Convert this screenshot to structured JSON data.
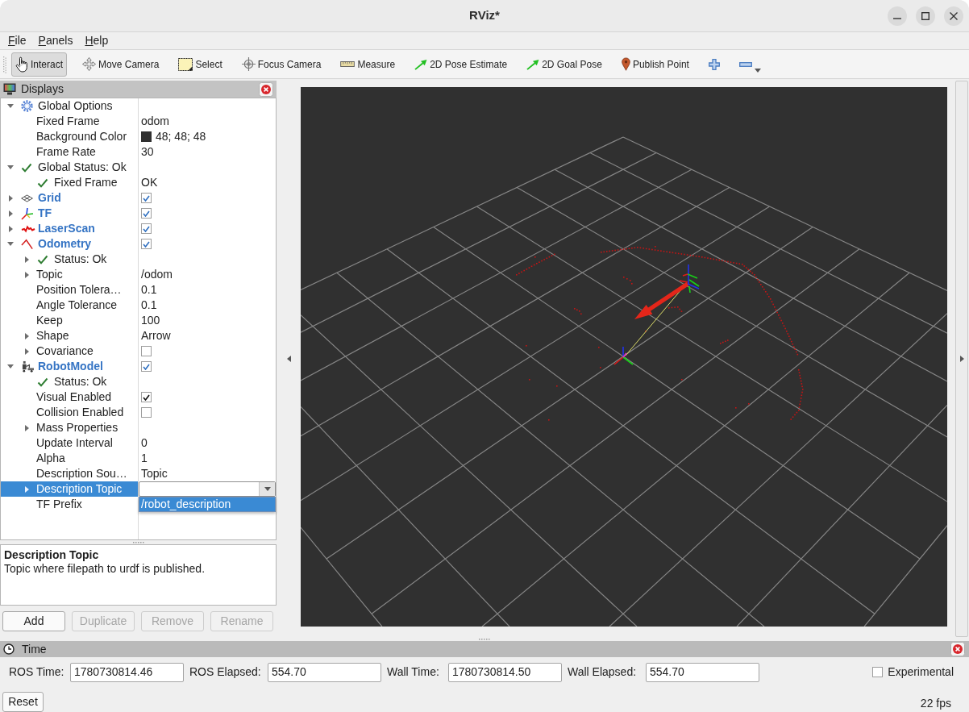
{
  "window": {
    "title": "RViz*"
  },
  "menu": [
    {
      "label": "File"
    },
    {
      "label": "Panels"
    },
    {
      "label": "Help"
    }
  ],
  "toolbar": [
    {
      "kind": "interact",
      "label": "Interact",
      "selected": true
    },
    {
      "kind": "move_camera",
      "label": "Move Camera",
      "selected": false
    },
    {
      "kind": "select",
      "label": "Select",
      "selected": false
    },
    {
      "kind": "focus_camera",
      "label": "Focus Camera",
      "selected": false
    },
    {
      "kind": "measure",
      "label": "Measure",
      "selected": false
    },
    {
      "kind": "pose_estimate",
      "label": "2D Pose Estimate",
      "selected": false
    },
    {
      "kind": "goal_pose",
      "label": "2D Goal Pose",
      "selected": false
    },
    {
      "kind": "publish_point",
      "label": "Publish Point",
      "selected": false
    },
    {
      "kind": "add_tool",
      "selected": false
    },
    {
      "kind": "remove_tool",
      "selected": false,
      "dropdown": true
    }
  ],
  "displays_panel": {
    "title": "Displays",
    "tree": [
      {
        "kind": "options",
        "label": "Global Options",
        "expanded": true,
        "selected": false,
        "children": [
          {
            "kind": "property",
            "label": "Fixed Frame",
            "value": "odom",
            "selected": false
          },
          {
            "kind": "property",
            "label": "Background Color",
            "value": "48; 48; 48",
            "color": "#303030",
            "selected": false
          },
          {
            "kind": "property",
            "label": "Frame Rate",
            "value": "30",
            "selected": false
          }
        ]
      },
      {
        "kind": "status",
        "label": "Global Status: Ok",
        "expanded": true,
        "selected": false,
        "children": [
          {
            "kind": "status",
            "label": "Fixed Frame",
            "value": "OK",
            "selected": false
          }
        ]
      },
      {
        "kind": "grid",
        "label": "Grid",
        "checked": true,
        "expanded": false,
        "selected": false
      },
      {
        "kind": "tf",
        "label": "TF",
        "checked": true,
        "expanded": false,
        "selected": false
      },
      {
        "kind": "laser_scan",
        "label": "LaserScan",
        "checked": true,
        "expanded": false,
        "selected": false
      },
      {
        "kind": "odometry",
        "label": "Odometry",
        "checked": true,
        "expanded": true,
        "selected": false,
        "children": [
          {
            "kind": "status",
            "label": "Status: Ok",
            "expanded": false,
            "selected": false
          },
          {
            "kind": "property",
            "label": "Topic",
            "value": "/odom",
            "expanded": false,
            "selected": false
          },
          {
            "kind": "property",
            "label": "Position Tolera…",
            "value": "0.1",
            "selected": false
          },
          {
            "kind": "property",
            "label": "Angle Tolerance",
            "value": "0.1",
            "selected": false
          },
          {
            "kind": "property",
            "label": "Keep",
            "value": "100",
            "selected": false
          },
          {
            "kind": "property",
            "label": "Shape",
            "value": "Arrow",
            "expanded": false,
            "selected": false
          },
          {
            "kind": "property",
            "label": "Covariance",
            "checked": false,
            "expanded": false,
            "selected": false
          }
        ]
      },
      {
        "kind": "robot_model",
        "label": "RobotModel",
        "checked": true,
        "expanded": true,
        "selected": false,
        "children": [
          {
            "kind": "status",
            "label": "Status: Ok",
            "selected": false
          },
          {
            "kind": "property",
            "label": "Visual Enabled",
            "checked": true,
            "selected": false
          },
          {
            "kind": "property",
            "label": "Collision Enabled",
            "checked": false,
            "selected": false
          },
          {
            "kind": "property",
            "label": "Mass Properties",
            "expanded": false,
            "selected": false
          },
          {
            "kind": "property",
            "label": "Update Interval",
            "value": "0",
            "selected": false
          },
          {
            "kind": "property",
            "label": "Alpha",
            "value": "1",
            "selected": false
          },
          {
            "kind": "property",
            "label": "Description Sou…",
            "value": "Topic",
            "selected": false
          },
          {
            "kind": "property",
            "label": "Description Topic",
            "expanded": false,
            "selected": true,
            "editor": {
              "options": [
                {
                  "label": "/robot_description",
                  "selected": true
                }
              ]
            }
          },
          {
            "kind": "property",
            "label": "TF Prefix",
            "selected": false
          }
        ]
      }
    ],
    "description": {
      "title": "Description Topic",
      "text": "Topic where filepath to urdf is published."
    },
    "buttons": [
      {
        "label": "Add",
        "disabled": false
      },
      {
        "label": "Duplicate",
        "disabled": true
      },
      {
        "label": "Remove",
        "disabled": true
      },
      {
        "label": "Rename",
        "disabled": true
      }
    ]
  },
  "time_panel": {
    "title": "Time",
    "fields": [
      {
        "label": "ROS Time:",
        "value": "1780730814.46"
      },
      {
        "label": "ROS Elapsed:",
        "value": "554.70"
      },
      {
        "label": "Wall Time:",
        "value": "1780730814.50"
      },
      {
        "label": "Wall Elapsed:",
        "value": "554.70"
      }
    ],
    "experimental": {
      "label": "Experimental",
      "checked": false
    },
    "reset_button": "Reset",
    "fps": "22 fps"
  }
}
